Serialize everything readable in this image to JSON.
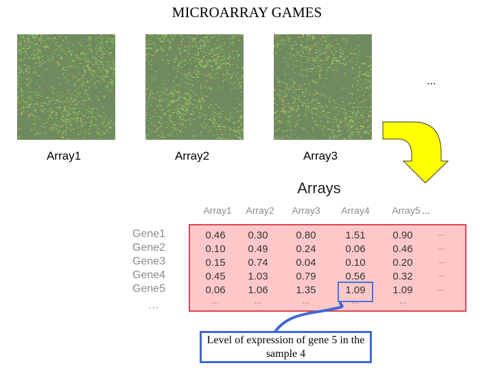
{
  "title": "MICROARRAY GAMES",
  "microarray_images": [
    {
      "label": "Array1"
    },
    {
      "label": "Array2"
    },
    {
      "label": "Array3"
    }
  ],
  "more_arrays_indicator": "...",
  "arrow_color": "#ffff00",
  "table": {
    "heading": "Arrays",
    "columns": [
      "Array1",
      "Array2",
      "Array3",
      "Array4",
      "Array5",
      "..."
    ],
    "rows": [
      {
        "gene": "Gene1",
        "values": [
          "0.46",
          "0.30",
          "0.80",
          "1.51",
          "0.90",
          "..."
        ]
      },
      {
        "gene": "Gene2",
        "values": [
          "0.10",
          "0.49",
          "0.24",
          "0.06",
          "0.46",
          "..."
        ]
      },
      {
        "gene": "Gene3",
        "values": [
          "0.15",
          "0.74",
          "0.04",
          "0.10",
          "0.20",
          "..."
        ]
      },
      {
        "gene": "Gene4",
        "values": [
          "0.45",
          "1.03",
          "0.79",
          "0.56",
          "0.32",
          "..."
        ]
      },
      {
        "gene": "Gene5",
        "values": [
          "0.06",
          "1.06",
          "1.35",
          "1.09",
          "1.09",
          "..."
        ]
      },
      {
        "gene": "...",
        "values": [
          "...",
          "...",
          "...",
          "...",
          "...",
          ""
        ]
      }
    ],
    "highlight": {
      "gene": "Gene5",
      "array": "Array4",
      "value": "1.09"
    },
    "box_color": "#ffc8c8",
    "box_border_color": "#d9464f"
  },
  "callout": {
    "text": "Level of expression of gene 5 in the sample 4",
    "border_color": "#3d68d6"
  }
}
